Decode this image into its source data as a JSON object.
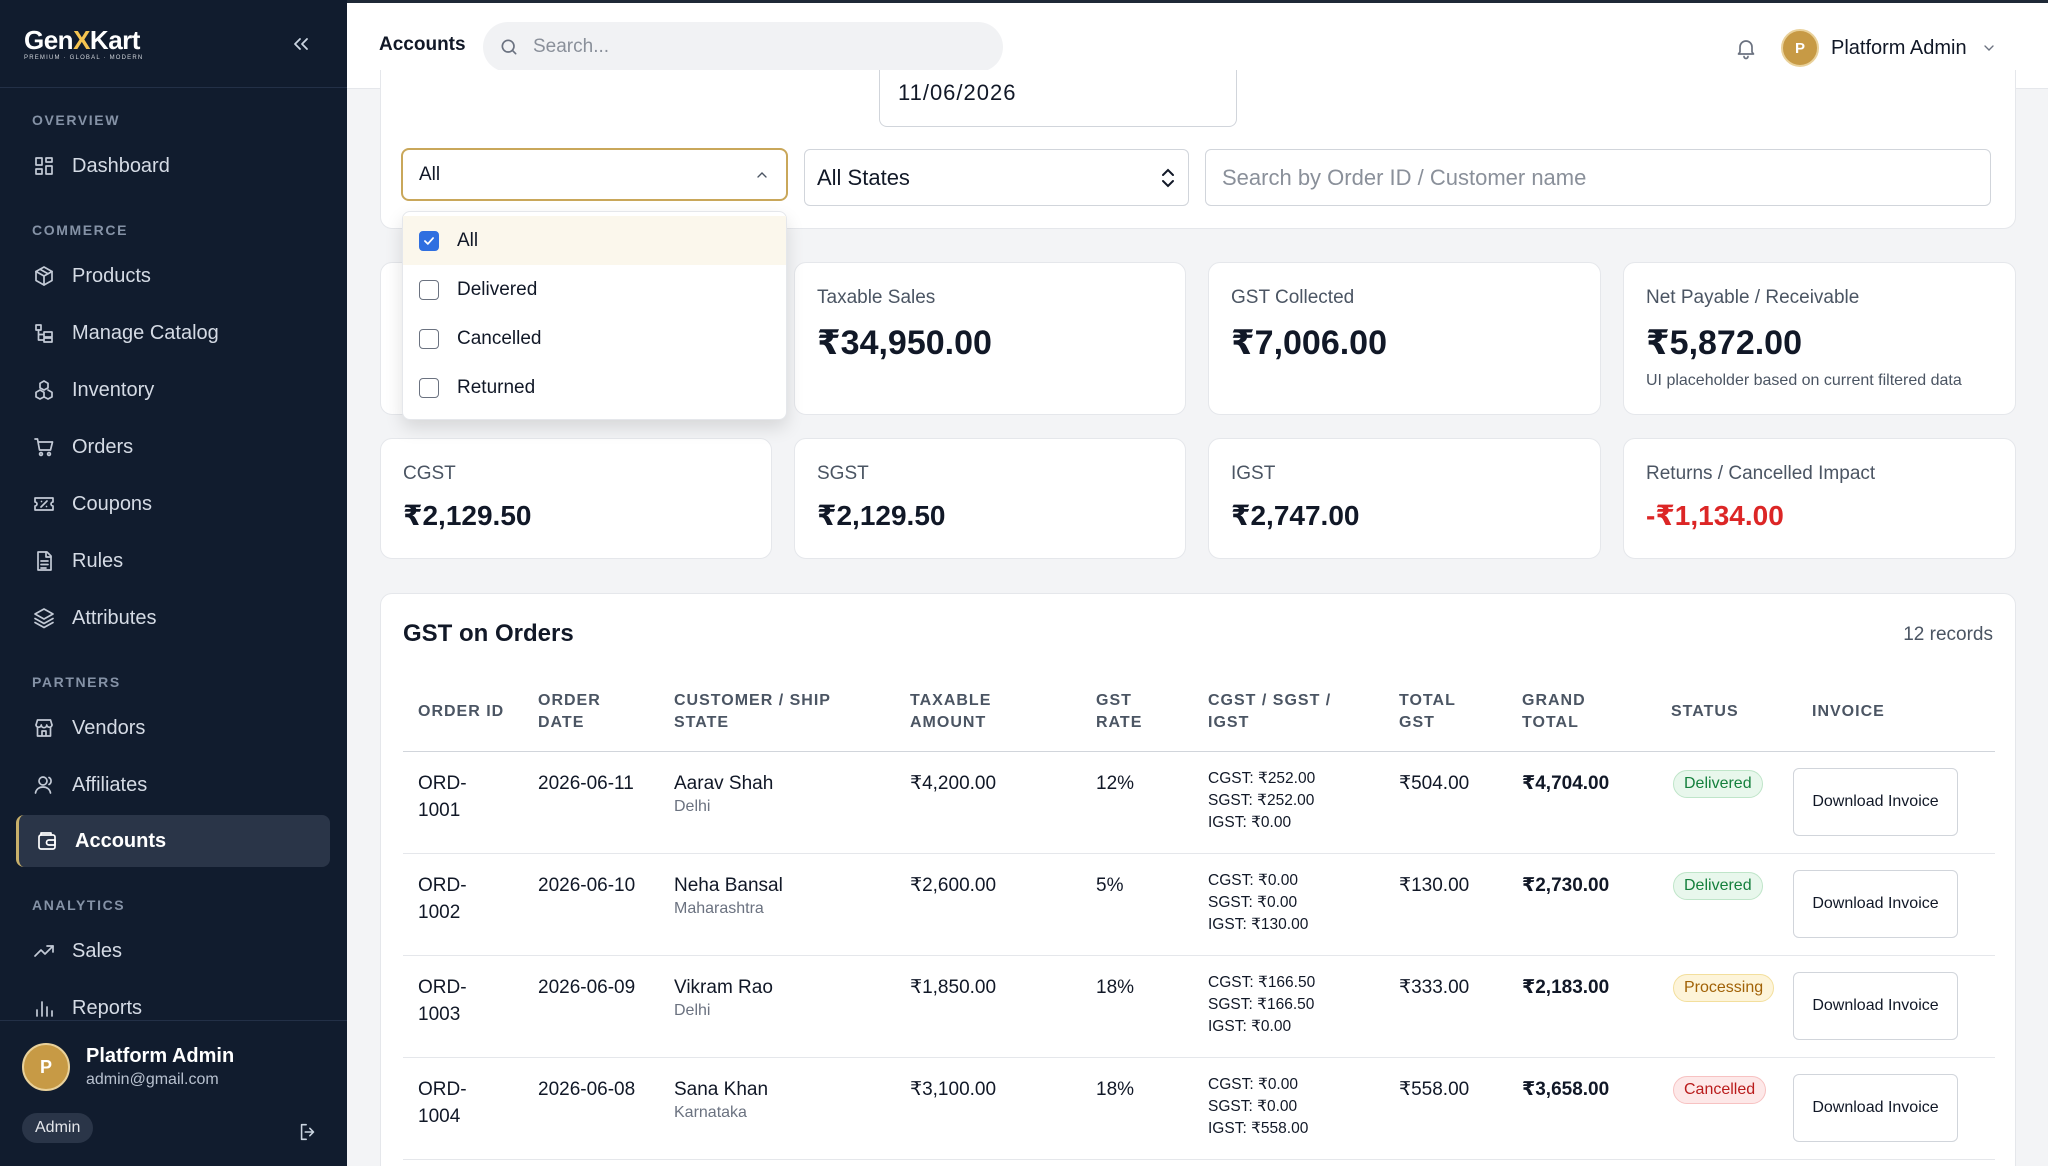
{
  "brand": {
    "name_a": "Gen",
    "name_x": "X",
    "name_b": "Kart",
    "tagline": "PREMIUM · GLOBAL · MODERN"
  },
  "sidebar": {
    "sections": [
      "OVERVIEW",
      "COMMERCE",
      "PARTNERS",
      "ANALYTICS"
    ],
    "items": [
      {
        "label": "Dashboard",
        "icon": "dashboard-icon"
      },
      {
        "label": "Products",
        "icon": "box-icon"
      },
      {
        "label": "Manage Catalog",
        "icon": "catalog-icon"
      },
      {
        "label": "Inventory",
        "icon": "inventory-icon"
      },
      {
        "label": "Orders",
        "icon": "cart-icon"
      },
      {
        "label": "Coupons",
        "icon": "coupon-icon"
      },
      {
        "label": "Rules",
        "icon": "document-icon"
      },
      {
        "label": "Attributes",
        "icon": "layers-icon"
      },
      {
        "label": "Vendors",
        "icon": "store-icon"
      },
      {
        "label": "Affiliates",
        "icon": "user-icon"
      },
      {
        "label": "Accounts",
        "icon": "wallet-icon",
        "active": true
      },
      {
        "label": "Sales",
        "icon": "trend-icon"
      },
      {
        "label": "Reports",
        "icon": "bar-chart-icon"
      }
    ],
    "user": {
      "initial": "P",
      "name": "Platform Admin",
      "email": "admin@gmail.com",
      "role": "Admin"
    }
  },
  "header": {
    "title": "Accounts",
    "search_placeholder": "Search...",
    "user_initial": "P",
    "user_name": "Platform Admin"
  },
  "filters": {
    "date_value": "11/06/2026",
    "status_value": "All",
    "status_options": [
      {
        "label": "All",
        "checked": true
      },
      {
        "label": "Delivered",
        "checked": false
      },
      {
        "label": "Cancelled",
        "checked": false
      },
      {
        "label": "Returned",
        "checked": false
      }
    ],
    "state_value": "All States",
    "order_search_placeholder": "Search by Order ID / Customer name"
  },
  "stats": {
    "taxable_sales": {
      "label": "Taxable Sales",
      "value": "₹34,950.00"
    },
    "gst_collected": {
      "label": "GST Collected",
      "value": "₹7,006.00"
    },
    "net_payable": {
      "label": "Net Payable / Receivable",
      "value": "₹5,872.00",
      "note": "UI placeholder based on current filtered data"
    },
    "cgst": {
      "label": "CGST",
      "value": "₹2,129.50"
    },
    "sgst": {
      "label": "SGST",
      "value": "₹2,129.50"
    },
    "igst": {
      "label": "IGST",
      "value": "₹2,747.00"
    },
    "returns": {
      "label": "Returns / Cancelled Impact",
      "value": "-₹1,134.00"
    }
  },
  "table": {
    "title": "GST on Orders",
    "count": "12 records",
    "columns": [
      "ORDER ID",
      "ORDER DATE",
      "CUSTOMER / SHIP STATE",
      "TAXABLE AMOUNT",
      "GST RATE",
      "CGST / SGST / IGST",
      "TOTAL GST",
      "GRAND TOTAL",
      "STATUS",
      "INVOICE"
    ],
    "download_label": "Download Invoice",
    "rows": [
      {
        "order_id": "ORD-1001",
        "date": "2026-06-11",
        "customer": "Aarav Shah",
        "state": "Delhi",
        "taxable": "₹4,200.00",
        "rate": "12%",
        "cgst": "CGST: ₹252.00",
        "sgst": "SGST: ₹252.00",
        "igst": "IGST: ₹0.00",
        "total_gst": "₹504.00",
        "grand_total": "₹4,704.00",
        "status": "Delivered"
      },
      {
        "order_id": "ORD-1002",
        "date": "2026-06-10",
        "customer": "Neha Bansal",
        "state": "Maharashtra",
        "taxable": "₹2,600.00",
        "rate": "5%",
        "cgst": "CGST: ₹0.00",
        "sgst": "SGST: ₹0.00",
        "igst": "IGST: ₹130.00",
        "total_gst": "₹130.00",
        "grand_total": "₹2,730.00",
        "status": "Delivered"
      },
      {
        "order_id": "ORD-1003",
        "date": "2026-06-09",
        "customer": "Vikram Rao",
        "state": "Delhi",
        "taxable": "₹1,850.00",
        "rate": "18%",
        "cgst": "CGST: ₹166.50",
        "sgst": "SGST: ₹166.50",
        "igst": "IGST: ₹0.00",
        "total_gst": "₹333.00",
        "grand_total": "₹2,183.00",
        "status": "Processing"
      },
      {
        "order_id": "ORD-1004",
        "date": "2026-06-08",
        "customer": "Sana Khan",
        "state": "Karnataka",
        "taxable": "₹3,100.00",
        "rate": "18%",
        "cgst": "CGST: ₹0.00",
        "sgst": "SGST: ₹0.00",
        "igst": "IGST: ₹558.00",
        "total_gst": "₹558.00",
        "grand_total": "₹3,658.00",
        "status": "Cancelled"
      }
    ]
  }
}
